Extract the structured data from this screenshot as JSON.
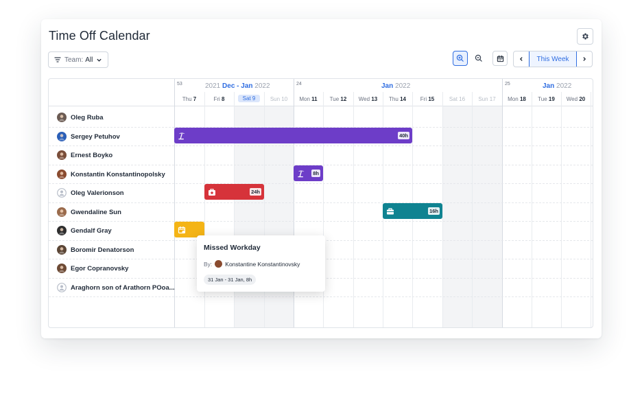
{
  "title": "Time Off Calendar",
  "toolbar": {
    "filter_prefix": "Team:",
    "filter_value": "All",
    "this_week_label": "This Week"
  },
  "calendar": {
    "weeks": [
      {
        "number": "53",
        "year_prefix": "2021",
        "month": "Dec - Jan",
        "year_suffix": "2022"
      },
      {
        "number": "24",
        "month": "Jan",
        "year_suffix": "2022"
      },
      {
        "number": "25",
        "month": "Jan",
        "year_suffix": "2022"
      }
    ],
    "days": [
      {
        "dow": "Thu",
        "num": "7",
        "weekend": false
      },
      {
        "dow": "Fri",
        "num": "8",
        "weekend": false
      },
      {
        "dow": "Sat",
        "num": "9",
        "weekend": true,
        "selected": true
      },
      {
        "dow": "Sun",
        "num": "10",
        "weekend": true
      },
      {
        "dow": "Mon",
        "num": "11",
        "weekend": false
      },
      {
        "dow": "Tue",
        "num": "12",
        "weekend": false
      },
      {
        "dow": "Wed",
        "num": "13",
        "weekend": false
      },
      {
        "dow": "Thu",
        "num": "14",
        "weekend": false
      },
      {
        "dow": "Fri",
        "num": "15",
        "weekend": false
      },
      {
        "dow": "Sat",
        "num": "16",
        "weekend": true
      },
      {
        "dow": "Sun",
        "num": "17",
        "weekend": true
      },
      {
        "dow": "Mon",
        "num": "18",
        "weekend": false
      },
      {
        "dow": "Tue",
        "num": "19",
        "weekend": false
      },
      {
        "dow": "Wed",
        "num": "20",
        "weekend": false
      }
    ],
    "people": [
      {
        "name": "Oleg Ruba",
        "avatar_color": "#6b5b53"
      },
      {
        "name": "Sergey Petuhov",
        "avatar_color": "#2b5fb7"
      },
      {
        "name": "Ernest Boyko",
        "avatar_color": "#7a4e3a"
      },
      {
        "name": "Konstantin Konstantinopolsky",
        "avatar_color": "#8a4b2f"
      },
      {
        "name": "Oleg Valerionson",
        "avatar_color": "#c5c9d3"
      },
      {
        "name": "Gwendaline Sun",
        "avatar_color": "#9a6b4c"
      },
      {
        "name": "Gendalf Gray",
        "avatar_color": "#2e2e2e"
      },
      {
        "name": "Boromir Denatorson",
        "avatar_color": "#5b4636"
      },
      {
        "name": "Egor Copranovsky",
        "avatar_color": "#6d4a35"
      },
      {
        "name": "Araghorn son of Arathorn POoa...",
        "avatar_color": "#c5c9d3"
      }
    ],
    "events": [
      {
        "person": "Sergey Petuhov",
        "type": "vacation",
        "icon": "beach-icon",
        "start_day": "Thu 7",
        "end_day": "Fri 15",
        "hours": "40h",
        "color": "#6d3dc8"
      },
      {
        "person": "Konstantin Konstantinopolsky",
        "type": "vacation",
        "icon": "beach-icon",
        "start_day": "Mon 11",
        "end_day": "Mon 11",
        "hours": "8h",
        "color": "#6d3dc8"
      },
      {
        "person": "Oleg Valerionson",
        "type": "sick leave",
        "icon": "medical-kit-icon",
        "start_day": "Fri 8",
        "end_day": "Sun 10",
        "hours": "24h",
        "color": "#d6333a"
      },
      {
        "person": "Gwendaline Sun",
        "type": "business trip",
        "icon": "briefcase-icon",
        "start_day": "Thu 14",
        "end_day": "Fri 15",
        "hours": "16h",
        "color": "#0f8391"
      },
      {
        "person": "Gendalf Gray",
        "type": "missed workday",
        "icon": "calendar-icon",
        "start_day": "Thu 7",
        "end_day": "Thu 7",
        "hours": "",
        "color": "#f4b416"
      }
    ]
  },
  "popup": {
    "title": "Missed Workday",
    "by_label": "By:",
    "author": "Konstantine Konstantinovsky",
    "range": "31 Jan - 31 Jan, 8h"
  },
  "icons": [
    "settings-gear-icon",
    "filter-icon",
    "chevron-down-icon",
    "zoom-in-icon",
    "zoom-out-icon",
    "calendar-icon",
    "chevron-left-icon",
    "chevron-right-icon",
    "beach-icon",
    "medical-kit-icon",
    "briefcase-icon",
    "user-placeholder-icon"
  ]
}
